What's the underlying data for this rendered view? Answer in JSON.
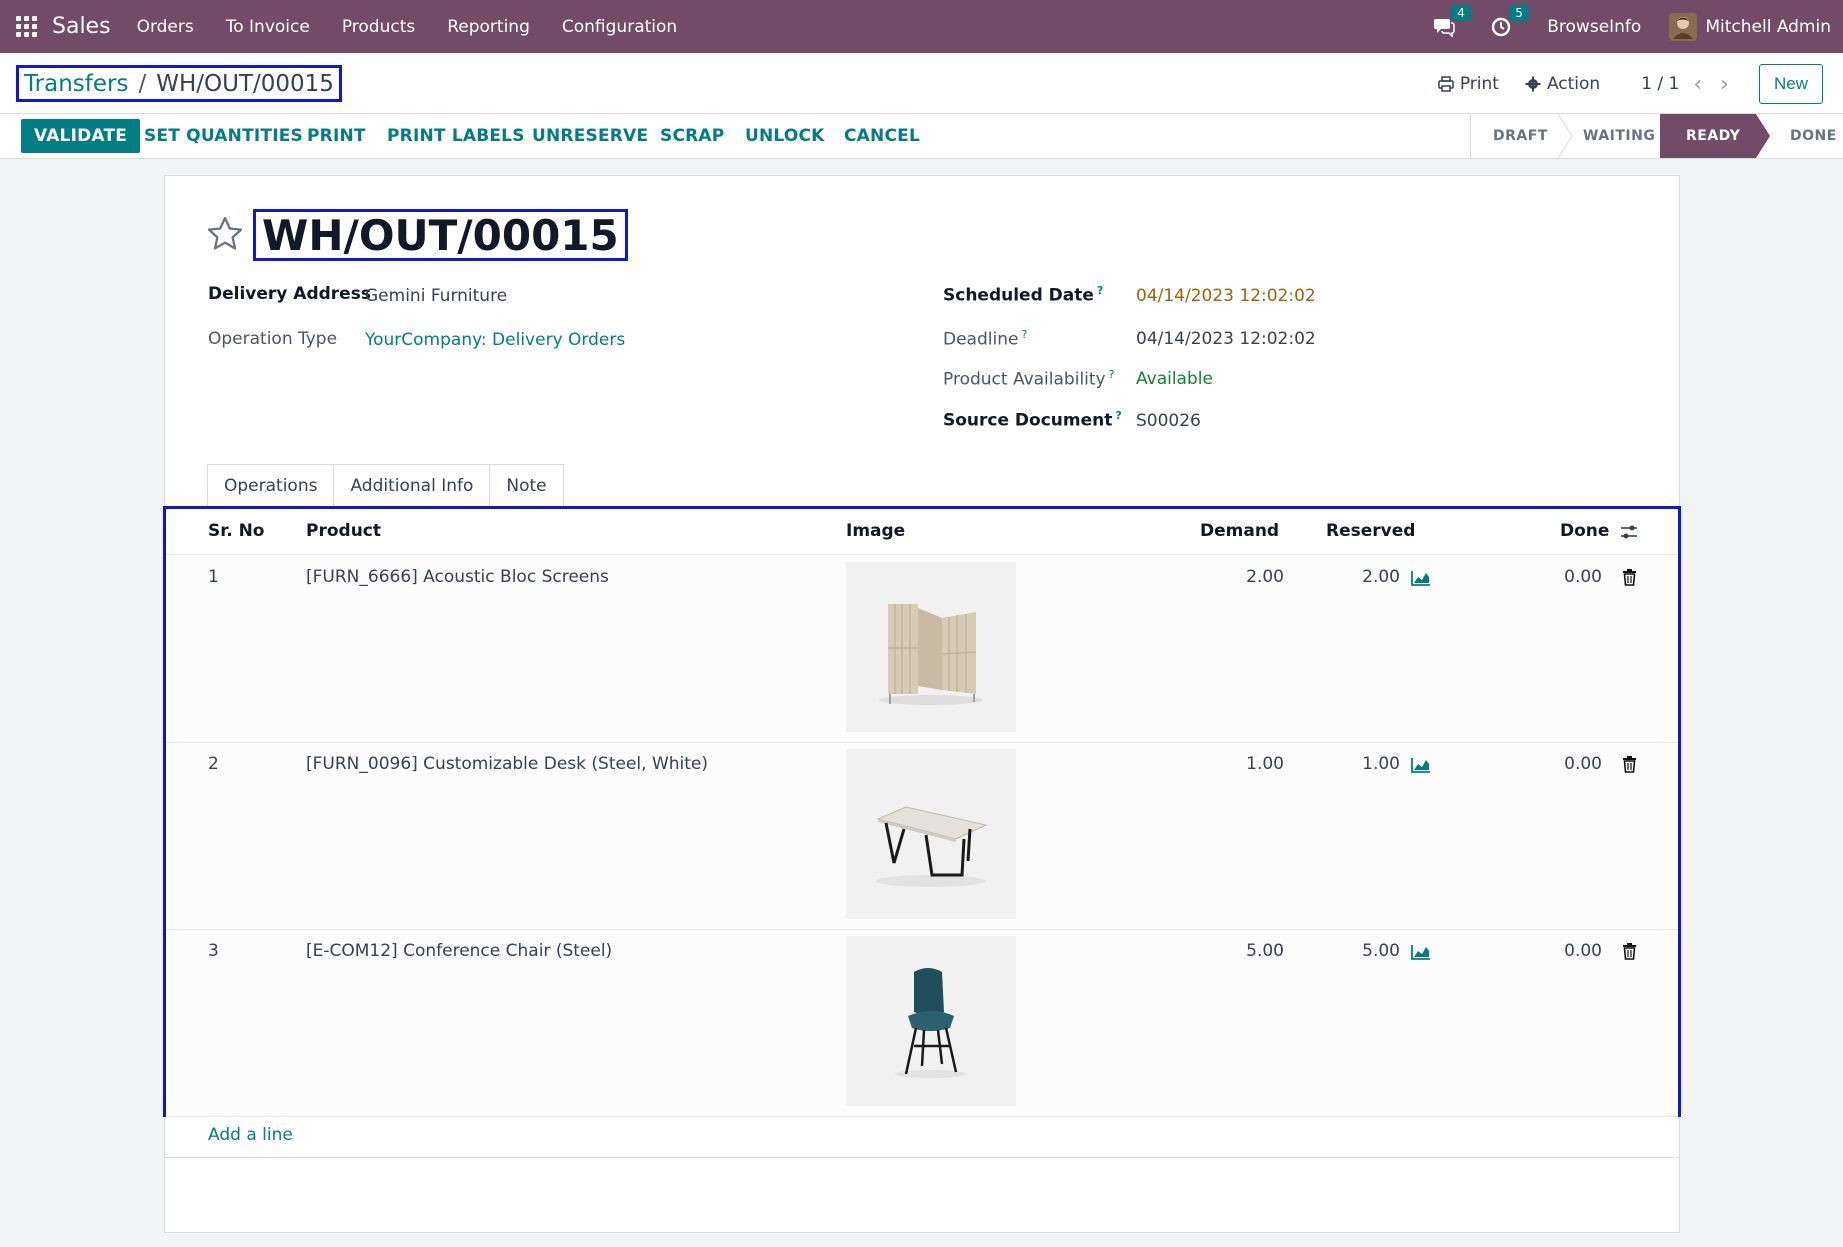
{
  "navbar": {
    "app_name": "Sales",
    "menu": [
      "Orders",
      "To Invoice",
      "Products",
      "Reporting",
      "Configuration"
    ],
    "messages_count": "4",
    "activities_count": "5",
    "company": "BrowseInfo",
    "user": "Mitchell Admin",
    "bg_color": "#714b67"
  },
  "breadcrumb": {
    "parent": "Transfers",
    "separator": "/",
    "current": "WH/OUT/00015"
  },
  "control": {
    "print_label": "Print",
    "action_label": "Action",
    "pager": "1 / 1",
    "prev_icon": "‹",
    "next_icon": "›",
    "new_label": "New"
  },
  "actions": {
    "validate": "VALIDATE",
    "set_quantities": "SET QUANTITIES",
    "print": "PRINT",
    "print_labels": "PRINT LABELS",
    "unreserve": "UNRESERVE",
    "scrap": "SCRAP",
    "unlock": "UNLOCK",
    "cancel": "CANCEL"
  },
  "status": {
    "stages": [
      "DRAFT",
      "WAITING",
      "READY",
      "DONE"
    ],
    "active": "READY"
  },
  "record": {
    "title": "WH/OUT/00015",
    "delivery_address_label": "Delivery Address",
    "delivery_address": "Gemini Furniture",
    "operation_type_label": "Operation Type",
    "operation_type": "YourCompany: Delivery Orders",
    "scheduled_date_label": "Scheduled Date",
    "scheduled_date": "04/14/2023 12:02:02",
    "deadline_label": "Deadline",
    "deadline": "04/14/2023 12:02:02",
    "availability_label": "Product Availability",
    "availability": "Available",
    "source_label": "Source Document",
    "source": "S00026",
    "help_mark": "?"
  },
  "tabs": [
    "Operations",
    "Additional Info",
    "Note"
  ],
  "table": {
    "columns": {
      "sr": "Sr. No",
      "product": "Product",
      "image": "Image",
      "demand": "Demand",
      "reserved": "Reserved",
      "done": "Done"
    },
    "rows": [
      {
        "sr": "1",
        "product": "[FURN_6666] Acoustic Bloc Screens",
        "image": "acoustic-screen-image",
        "demand": "2.00",
        "reserved": "2.00",
        "done": "0.00"
      },
      {
        "sr": "2",
        "product": "[FURN_0096] Customizable Desk (Steel, White)",
        "image": "desk-image",
        "demand": "1.00",
        "reserved": "1.00",
        "done": "0.00"
      },
      {
        "sr": "3",
        "product": "[E-COM12] Conference Chair (Steel)",
        "image": "chair-image",
        "demand": "5.00",
        "reserved": "5.00",
        "done": "0.00"
      }
    ],
    "add_line": "Add a line"
  },
  "colors": {
    "accent": "#017e84",
    "brand": "#714b67",
    "highlight_box": "#1414d6",
    "date_warning": "#a16207",
    "available": "#15803d"
  }
}
